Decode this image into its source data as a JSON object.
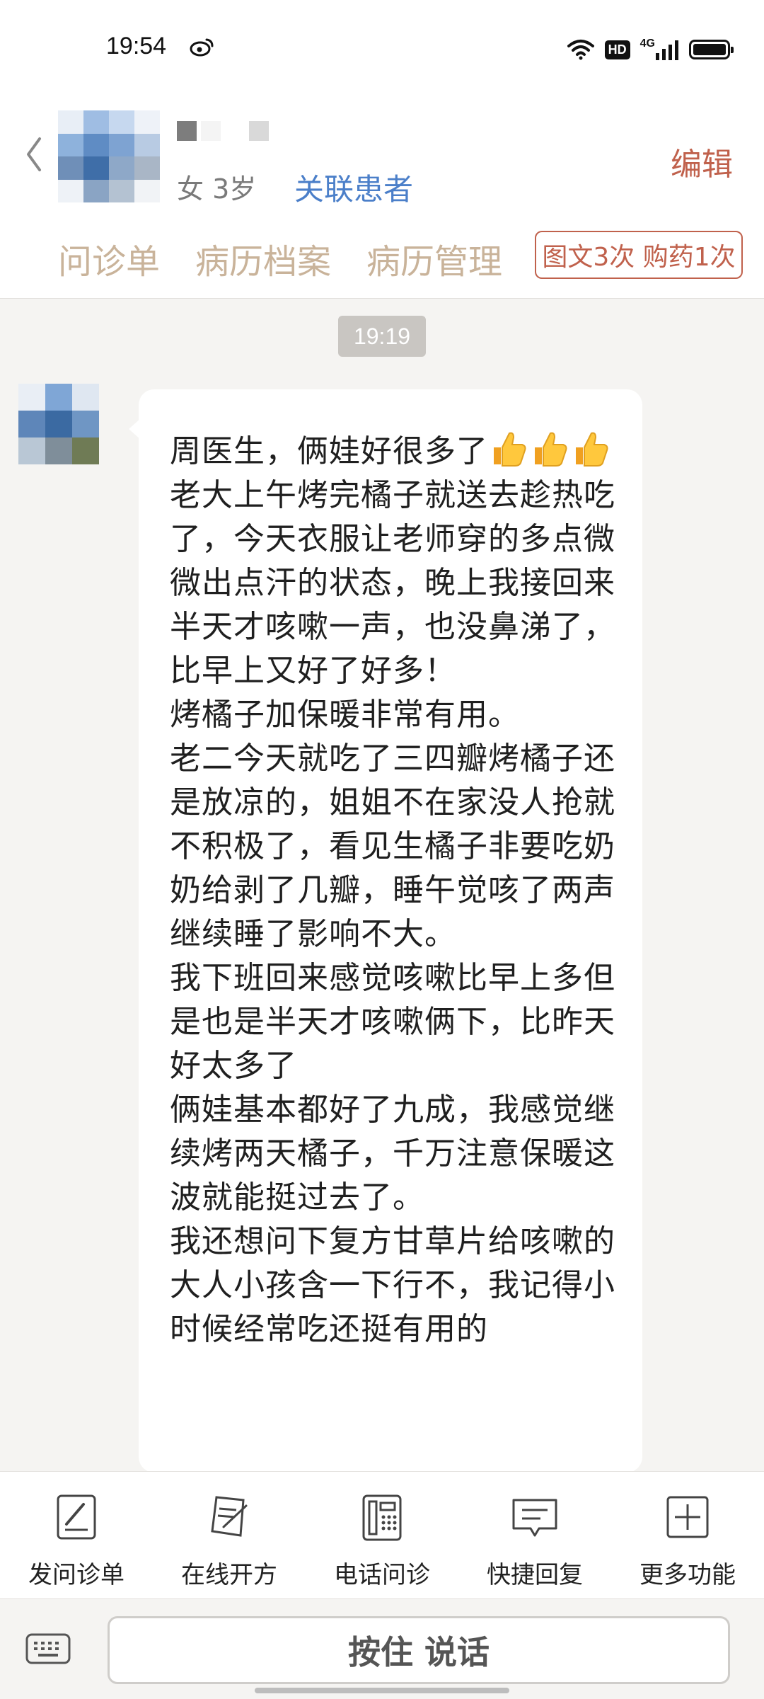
{
  "status_bar": {
    "time": "19:54",
    "network": "4G",
    "hd": "HD",
    "battery_level": 1.0,
    "icons": [
      "weibo-icon",
      "wifi-icon",
      "signal-icon",
      "battery-icon"
    ]
  },
  "header": {
    "patient_info": "女 3岁",
    "link_patient": "关联患者",
    "edit": "编辑",
    "tabs": [
      "问诊单",
      "病历档案",
      "病历管理"
    ],
    "quota": "图文3次 购药1次"
  },
  "chat": {
    "time": "19:19",
    "message": "周医生，俩娃好很多了\n老大上午烤完橘子就送去趁热吃了，今天衣服让老师穿的多点微微出点汗的状态，晚上我接回来半天才咳嗽一声，也没鼻涕了，比早上又好了好多！\n烤橘子加保暖非常有用。\n老二今天就吃了三四瓣烤橘子还是放凉的，姐姐不在家没人抢就不积极了，看见生橘子非要吃奶奶给剥了几瓣，睡午觉咳了两声继续睡了影响不大。\n我下班回来感觉咳嗽比早上多但是也是半天才咳嗽俩下，比昨天好太多了\n俩娃基本都好了九成，我感觉继续烤两天橘子，千万注意保暖这波就能挺过去了。\n我还想问下复方甘草片给咳嗽的大人小孩含一下行不，我记得小时候经常吃还挺有用的"
  },
  "toolbar": {
    "items": [
      {
        "label": "发问诊单",
        "icon": "form-edit-icon"
      },
      {
        "label": "在线开方",
        "icon": "prescription-icon"
      },
      {
        "label": "电话问诊",
        "icon": "phone-icon"
      },
      {
        "label": "快捷回复",
        "icon": "quick-reply-icon"
      },
      {
        "label": "更多功能",
        "icon": "plus-box-icon"
      }
    ]
  },
  "input": {
    "hold_to_talk": "按住 说话"
  },
  "colors": {
    "accent": "#c0614c",
    "tab": "#c9b39a",
    "link": "#4b7fc9",
    "background": "#f5f4f2"
  }
}
